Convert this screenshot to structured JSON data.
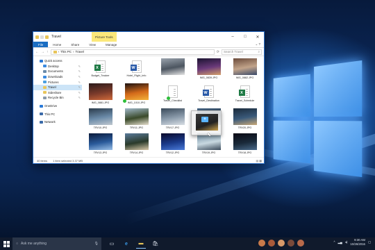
{
  "explorer": {
    "title": "Travel",
    "context_tab": "Picture Tools",
    "ribbon_tabs": [
      "File",
      "Home",
      "Share",
      "View",
      "Manage"
    ],
    "breadcrumb": [
      "This PC",
      "Travel"
    ],
    "search_placeholder": "Search Travel",
    "sidebar": [
      {
        "label": "Quick access",
        "icon": "star-icon",
        "pinned": false,
        "sub": false
      },
      {
        "label": "Desktop",
        "icon": "desktop-icon",
        "pinned": true,
        "sub": true
      },
      {
        "label": "Documents",
        "icon": "documents-icon",
        "pinned": true,
        "sub": true
      },
      {
        "label": "Downloads",
        "icon": "downloads-icon",
        "pinned": true,
        "sub": true
      },
      {
        "label": "Pictures",
        "icon": "pictures-icon",
        "pinned": true,
        "sub": true
      },
      {
        "label": "Travel",
        "icon": "folder-icon",
        "pinned": true,
        "sub": true,
        "selected": true
      },
      {
        "label": "Sideshare",
        "icon": "folder-icon",
        "pinned": true,
        "sub": true
      },
      {
        "label": "Recycle Bin",
        "icon": "recycle-bin-icon",
        "pinned": true,
        "sub": true
      },
      {
        "label": "OneDrive",
        "icon": "onedrive-icon",
        "pinned": false,
        "sub": false,
        "gap_before": true
      },
      {
        "label": "This PC",
        "icon": "this-pc-icon",
        "pinned": false,
        "sub": false,
        "gap_before": true
      },
      {
        "label": "Network",
        "icon": "network-icon",
        "pinned": false,
        "sub": false,
        "gap_before": true
      }
    ],
    "files": [
      {
        "name": "Budget_Tracker",
        "kind": "excel"
      },
      {
        "name": "Hotel_Flight_Info",
        "kind": "word"
      },
      {
        "name": "",
        "kind": "photo",
        "colors": [
          "#9aa3ad",
          "#4c5560",
          "#e6e6e6"
        ]
      },
      {
        "name": "IMG_0839.JPG",
        "kind": "photo",
        "colors": [
          "#1a1330",
          "#6b3a7a",
          "#d4a06a"
        ]
      },
      {
        "name": "IMG_0882.JPG",
        "kind": "photo",
        "colors": [
          "#6a4a3a",
          "#c2a48a",
          "#3a4a6a"
        ]
      },
      {
        "name": "IMG_0881.JPG",
        "kind": "photo",
        "colors": [
          "#2a1a1a",
          "#7a3a2a",
          "#d06a3a"
        ]
      },
      {
        "name": "IMG_1010.JPG",
        "kind": "photo",
        "colors": [
          "#1a1010",
          "#d46a1a",
          "#f3b23a"
        ],
        "synced": true
      },
      {
        "name": "Travel_Checklist",
        "kind": "doc",
        "synced": true
      },
      {
        "name": "Travel_Destination",
        "kind": "word"
      },
      {
        "name": "Travel_Schedule",
        "kind": "excel"
      },
      {
        "name": "TRV10.JPG",
        "kind": "photo",
        "colors": [
          "#2a3a4a",
          "#6a8aa8",
          "#c0c8d0"
        ]
      },
      {
        "name": "TRV11.JPG",
        "kind": "photo",
        "colors": [
          "#a0b8c8",
          "#3a4a2a",
          "#e8e0d0"
        ]
      },
      {
        "name": "TRV17.JPG",
        "kind": "photo",
        "colors": [
          "#3a4a5a",
          "#8a9aaa",
          "#d8dee4"
        ]
      },
      {
        "name": "TRV16.JPG",
        "kind": "photo",
        "colors": [
          "#4a6a8a",
          "#2a3a4a",
          "#b8c8d8"
        ]
      },
      {
        "name": "TRV20.JPG",
        "kind": "photo",
        "colors": [
          "#1a2a3a",
          "#3a5a7a",
          "#c8a878"
        ]
      },
      {
        "name": "TRV13.JPG",
        "kind": "photo",
        "colors": [
          "#0a1a3a",
          "#2a5a9a",
          "#9ac0e8"
        ]
      },
      {
        "name": "TRV14.JPG",
        "kind": "photo",
        "colors": [
          "#5a7a9a",
          "#2a3a2a",
          "#d8c8a8"
        ]
      },
      {
        "name": "TRV12.JPG",
        "kind": "photo",
        "colors": [
          "#0a0a2a",
          "#1a3a8a",
          "#4a7ad8"
        ]
      },
      {
        "name": "TRV19.JPG",
        "kind": "photo",
        "colors": [
          "#6a8aa0",
          "#c8d8e0",
          "#3a4a5a"
        ]
      },
      {
        "name": "TRV18.JPG",
        "kind": "photo",
        "colors": [
          "#0a0a14",
          "#1a2a3a",
          "#4a6a8a"
        ]
      }
    ],
    "status": {
      "items": "40 items",
      "selected": "1 item selected 3.37 MB"
    }
  },
  "taskbar": {
    "search_placeholder": "Ask me anything",
    "apps": [
      "task-view-icon",
      "edge-icon",
      "file-explorer-icon",
      "store-icon"
    ],
    "people_colors": [
      "#c87a4a",
      "#a85a3a",
      "#d89a6a",
      "#7a4a3a",
      "#b86a4a"
    ],
    "time": "9:30 AM",
    "date": "10/26/2016"
  },
  "colors": {
    "accent": "#1b6ec2",
    "selection": "#cce4f7",
    "context_tab": "#fbe87a"
  }
}
